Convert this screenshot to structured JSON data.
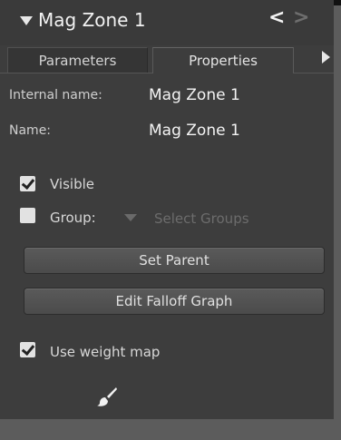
{
  "header": {
    "title": "Mag Zone 1",
    "back_glyph": "<",
    "forward_glyph": ">"
  },
  "tabs": [
    {
      "label": "Parameters",
      "active": false
    },
    {
      "label": "Properties",
      "active": true
    }
  ],
  "properties": {
    "internal_name_label": "Internal name:",
    "internal_name_value": "Mag Zone 1",
    "name_label": "Name:",
    "name_value": "Mag Zone 1"
  },
  "visible": {
    "label": "Visible",
    "checked": true
  },
  "group": {
    "label": "Group:",
    "checked": false,
    "placeholder": "Select Groups"
  },
  "buttons": {
    "set_parent": "Set Parent",
    "edit_falloff_graph": "Edit Falloff Graph"
  },
  "weight_map": {
    "label": "Use weight map",
    "checked": true
  },
  "icons": {
    "header_caret": "caret-down-icon",
    "tab_scroll": "caret-right-icon",
    "brush": "paint-brush-icon"
  },
  "colors": {
    "panel_bg": "#3d3d3d",
    "checkbox_fill": "#e2e2e2",
    "disabled_text": "#6c6c6c"
  }
}
